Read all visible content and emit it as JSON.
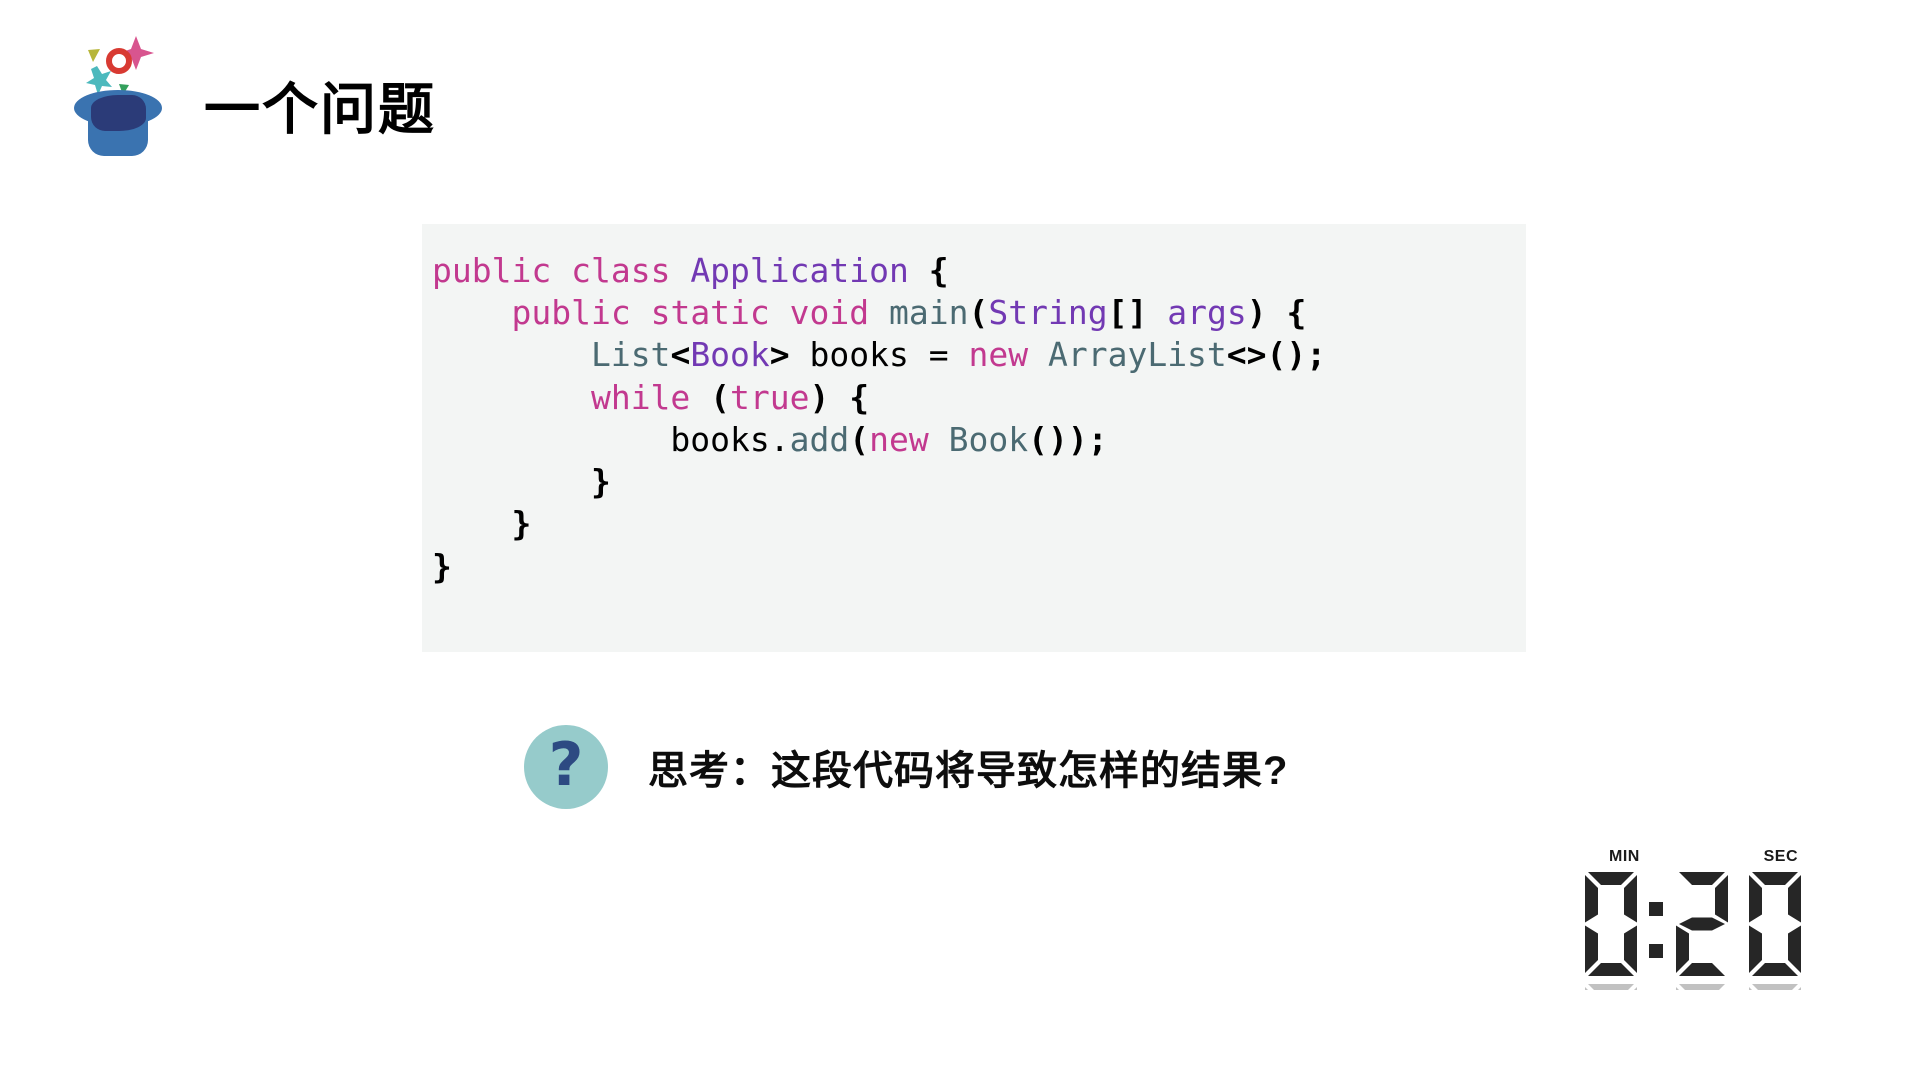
{
  "slide": {
    "title": "一个问题",
    "icon": "magic-hat-icon"
  },
  "code_block": {
    "language": "java",
    "background": "#f3f5f4",
    "lines": [
      {
        "n": 1,
        "text": "public class Application {",
        "tokens": [
          {
            "t": "public",
            "c": "kw"
          },
          {
            "t": " ",
            "c": "id"
          },
          {
            "t": "class",
            "c": "kw"
          },
          {
            "t": " ",
            "c": "id"
          },
          {
            "t": "Application",
            "c": "cls"
          },
          {
            "t": " ",
            "c": "id"
          },
          {
            "t": "{",
            "c": "pn"
          }
        ]
      },
      {
        "n": 2,
        "text": "    public static void main(String[] args) {",
        "tokens": [
          {
            "t": "    ",
            "c": "id"
          },
          {
            "t": "public",
            "c": "kw"
          },
          {
            "t": " ",
            "c": "id"
          },
          {
            "t": "static",
            "c": "kw"
          },
          {
            "t": " ",
            "c": "id"
          },
          {
            "t": "void",
            "c": "kw"
          },
          {
            "t": " ",
            "c": "id"
          },
          {
            "t": "main",
            "c": "typ"
          },
          {
            "t": "(",
            "c": "pn"
          },
          {
            "t": "String",
            "c": "cls"
          },
          {
            "t": "[]",
            "c": "pn"
          },
          {
            "t": " ",
            "c": "id"
          },
          {
            "t": "args",
            "c": "cls"
          },
          {
            "t": ")",
            "c": "pn"
          },
          {
            "t": " ",
            "c": "id"
          },
          {
            "t": "{",
            "c": "pn"
          }
        ]
      },
      {
        "n": 3,
        "text": "        List<Book> books = new ArrayList<>();",
        "tokens": [
          {
            "t": "        ",
            "c": "id"
          },
          {
            "t": "List",
            "c": "typ"
          },
          {
            "t": "<",
            "c": "pn"
          },
          {
            "t": "Book",
            "c": "cls"
          },
          {
            "t": ">",
            "c": "pn"
          },
          {
            "t": " books ",
            "c": "id"
          },
          {
            "t": "=",
            "c": "id"
          },
          {
            "t": " ",
            "c": "id"
          },
          {
            "t": "new",
            "c": "kw"
          },
          {
            "t": " ",
            "c": "id"
          },
          {
            "t": "ArrayList",
            "c": "typ"
          },
          {
            "t": "<>();",
            "c": "pn"
          }
        ]
      },
      {
        "n": 4,
        "text": "        while (true) {",
        "tokens": [
          {
            "t": "        ",
            "c": "id"
          },
          {
            "t": "while",
            "c": "kw"
          },
          {
            "t": " ",
            "c": "id"
          },
          {
            "t": "(",
            "c": "pn"
          },
          {
            "t": "true",
            "c": "kw"
          },
          {
            "t": ")",
            "c": "pn"
          },
          {
            "t": " ",
            "c": "id"
          },
          {
            "t": "{",
            "c": "pn"
          }
        ]
      },
      {
        "n": 5,
        "text": "            books.add(new Book());",
        "tokens": [
          {
            "t": "            ",
            "c": "id"
          },
          {
            "t": "books",
            "c": "id"
          },
          {
            "t": ".",
            "c": "id"
          },
          {
            "t": "add",
            "c": "typ"
          },
          {
            "t": "(",
            "c": "pn"
          },
          {
            "t": "new",
            "c": "kw"
          },
          {
            "t": " ",
            "c": "id"
          },
          {
            "t": "Book",
            "c": "typ"
          },
          {
            "t": "());",
            "c": "pn"
          }
        ]
      },
      {
        "n": 6,
        "text": "        }",
        "tokens": [
          {
            "t": "        ",
            "c": "id"
          },
          {
            "t": "}",
            "c": "pn"
          }
        ]
      },
      {
        "n": 7,
        "text": "    }",
        "tokens": [
          {
            "t": "    ",
            "c": "id"
          },
          {
            "t": "}",
            "c": "pn"
          }
        ]
      },
      {
        "n": 8,
        "text": "}",
        "tokens": [
          {
            "t": "}",
            "c": "pn"
          }
        ]
      }
    ]
  },
  "question": {
    "badge_icon": "question-mark-icon",
    "badge_color": "#96cbcb",
    "badge_glyph": "?",
    "text": "思考：这段代码将导致怎样的结果?"
  },
  "timer": {
    "min_label": "MIN",
    "sec_label": "SEC",
    "minutes": "0",
    "separator": ":",
    "seconds": "20",
    "display": "0:20",
    "color": "#262626"
  },
  "palette": {
    "keyword": "#c2398f",
    "class_name": "#7239b3",
    "type_name": "#4b6a72",
    "punctuation": "#000000",
    "code_bg": "#f3f5f4",
    "hat_blue": "#3a73b0",
    "hat_navy": "#2b3b78",
    "confetti_pink": "#d8558f",
    "confetti_olive": "#b7b63a",
    "confetti_red": "#d83a32",
    "confetti_teal": "#4cb9bd",
    "confetti_green": "#34a05c"
  }
}
